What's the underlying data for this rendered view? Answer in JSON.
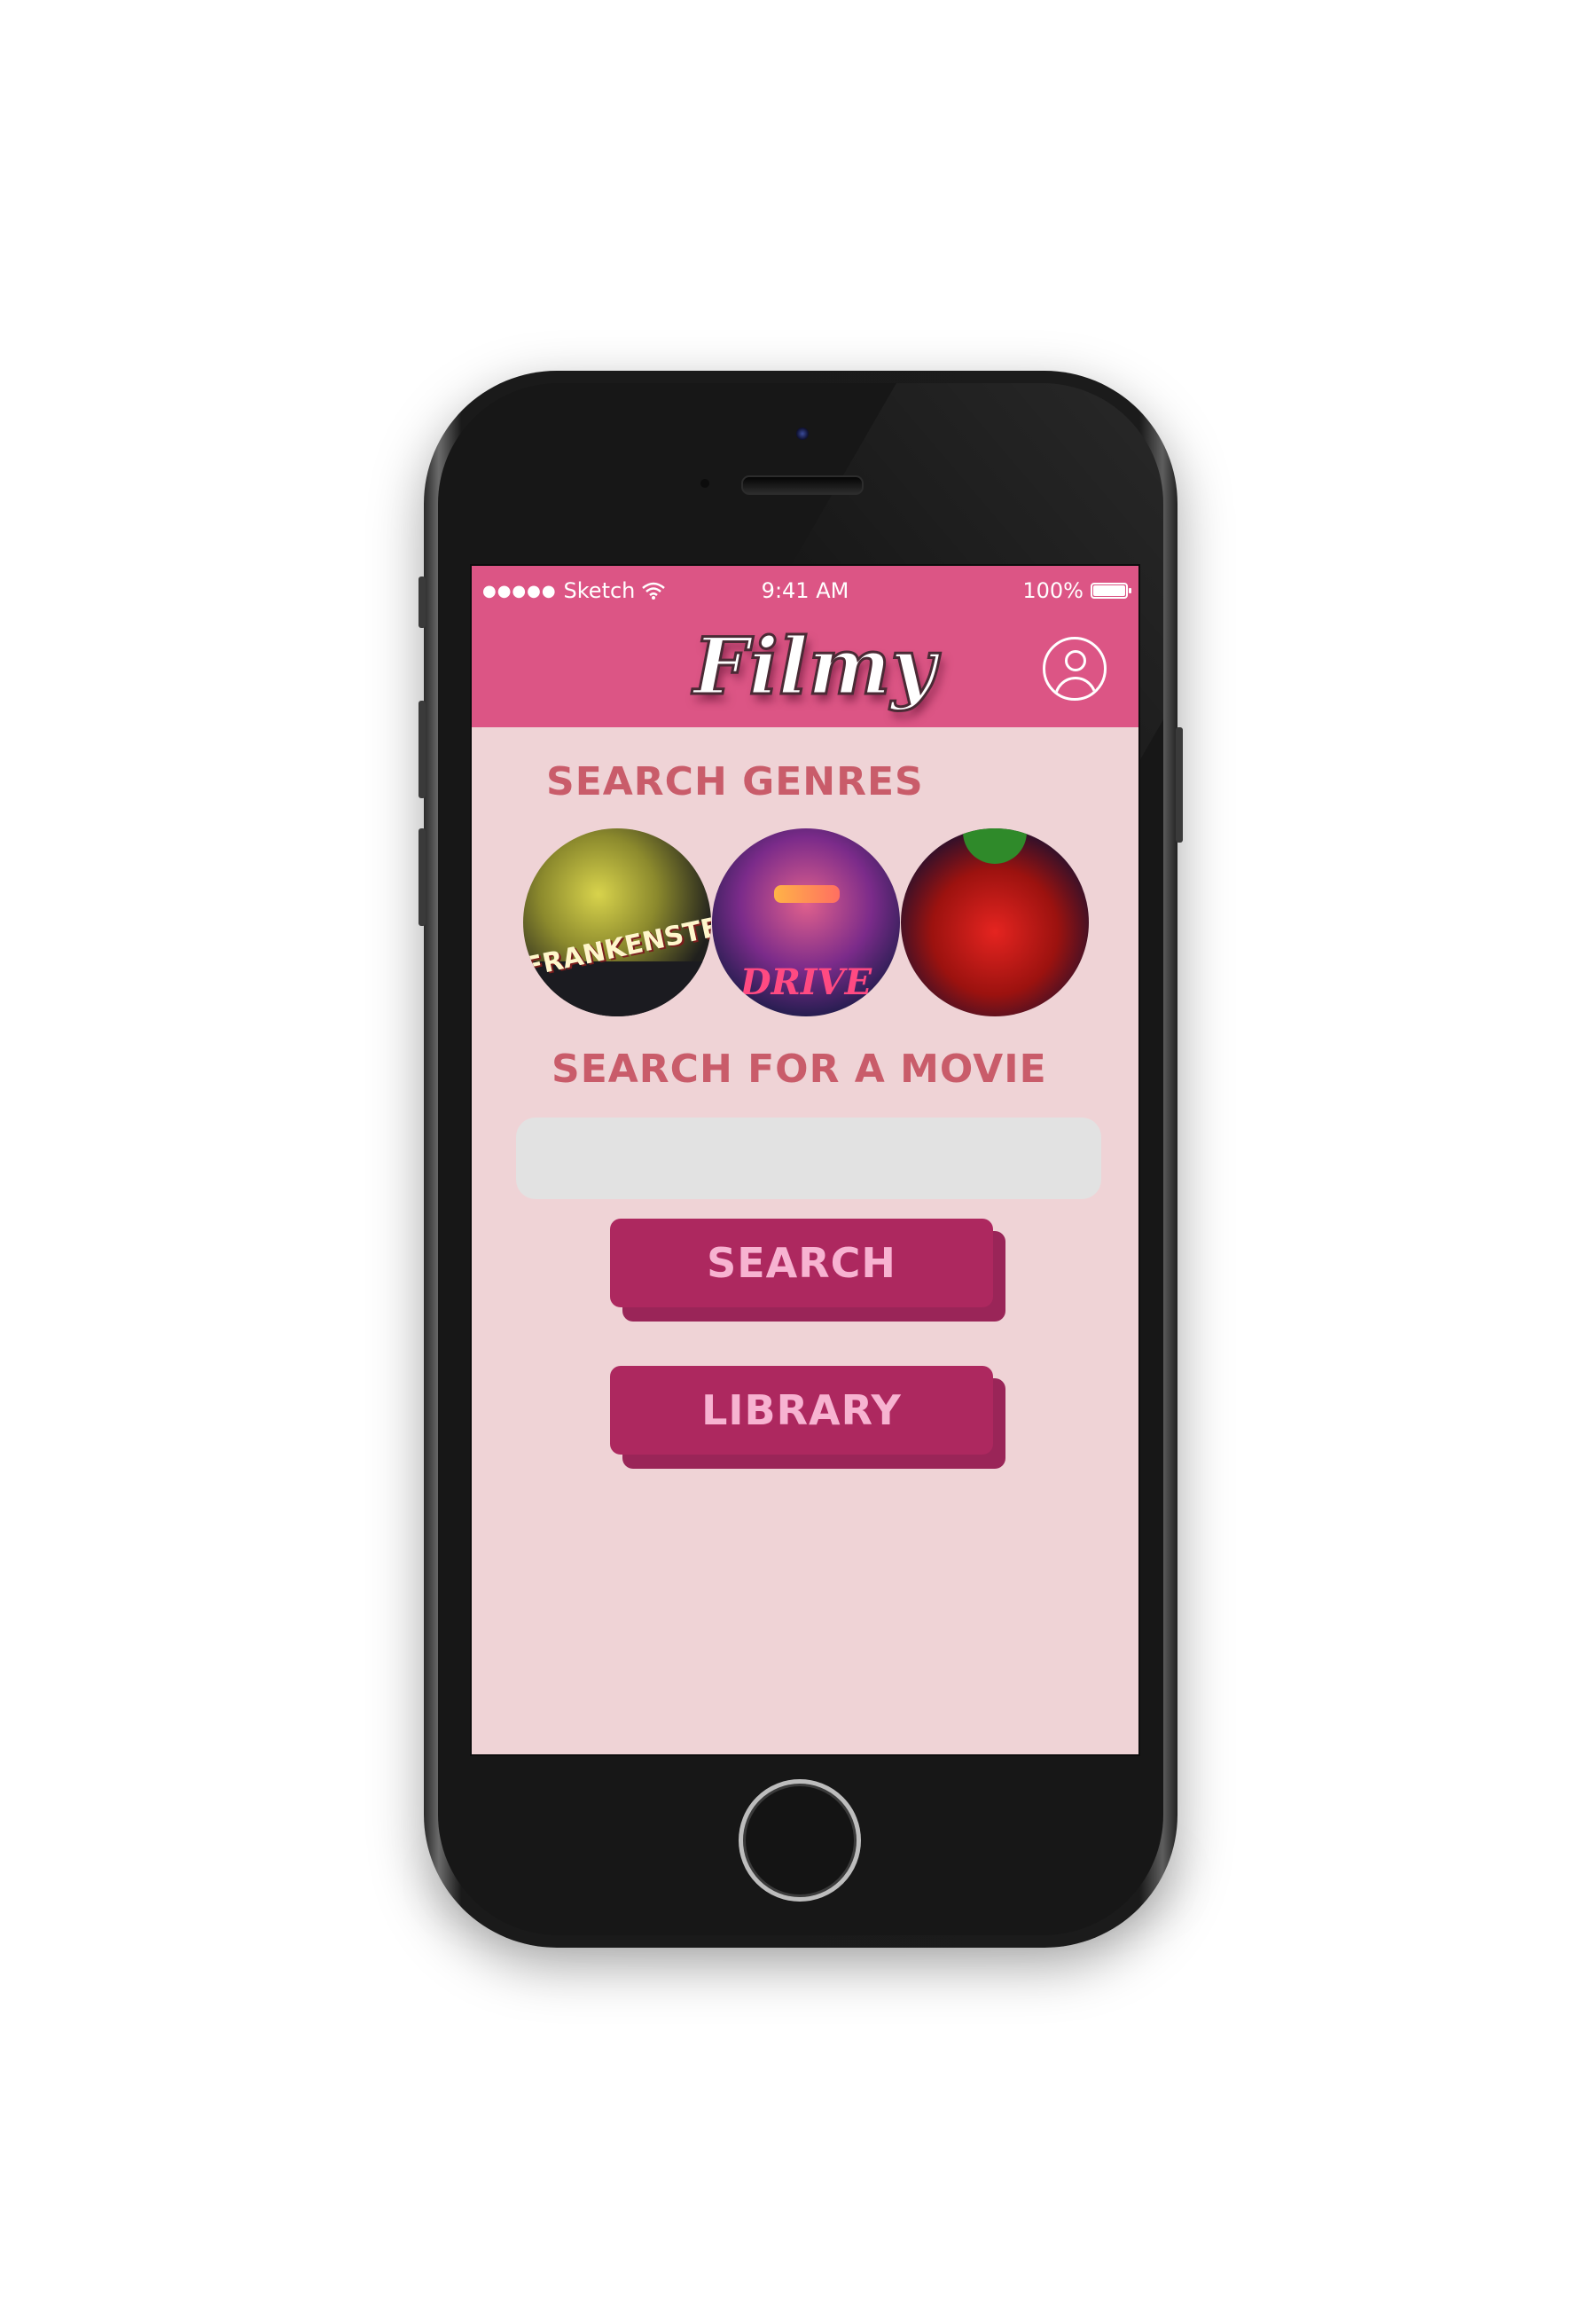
{
  "status_bar": {
    "signal_dots": "●●●●●",
    "carrier": "Sketch",
    "time": "9:41 AM",
    "battery": "100%"
  },
  "app": {
    "logo": "Filmy"
  },
  "genres": {
    "title": "SEARCH GENRES",
    "items": [
      {
        "name": "FRANKENSTEIN"
      },
      {
        "name": "DRIVE"
      },
      {
        "name": ""
      }
    ]
  },
  "movie_search": {
    "title": "SEARCH FOR A MOVIE",
    "placeholder": "",
    "value": ""
  },
  "buttons": {
    "search_label": "SEARCH",
    "library_label": "LIBRARY"
  },
  "colors": {
    "header": "#dc5585",
    "background": "#efd3d6",
    "title": "#c95c6a",
    "button": "#ad285f",
    "button_text": "#f7b3d1"
  },
  "icons": {
    "profile": "user-circle-icon",
    "wifi": "wifi-icon",
    "battery": "battery-icon"
  }
}
